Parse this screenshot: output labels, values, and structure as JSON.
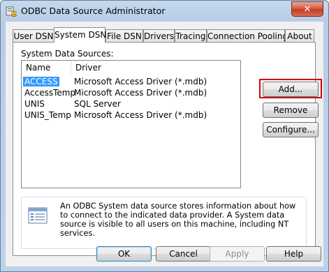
{
  "window": {
    "title": "ODBC Data Source Administrator",
    "close_glyph": "✕"
  },
  "tabs": [
    {
      "label": "User DSN",
      "active": false
    },
    {
      "label": "System DSN",
      "active": true
    },
    {
      "label": "File DSN",
      "active": false
    },
    {
      "label": "Drivers",
      "active": false
    },
    {
      "label": "Tracing",
      "active": false
    },
    {
      "label": "Connection Pooling",
      "active": false
    },
    {
      "label": "About",
      "active": false
    }
  ],
  "system_dsn": {
    "section_label": "System Data Sources:",
    "columns": [
      "Name",
      "Driver"
    ],
    "rows": [
      {
        "name": "ACCESS",
        "driver": "Microsoft Access Driver (*.mdb)",
        "selected": true
      },
      {
        "name": "AccessTemp",
        "driver": "Microsoft Access Driver (*.mdb)",
        "selected": false
      },
      {
        "name": "UNIS",
        "driver": "SQL Server",
        "selected": false
      },
      {
        "name": "UNIS_Temp",
        "driver": "Microsoft Access Driver (*.mdb)",
        "selected": false
      }
    ],
    "buttons": {
      "add": "Add...",
      "remove": "Remove",
      "configure": "Configure..."
    },
    "info_text": "An ODBC System data source stores information about how to connect to the indicated data provider.   A System data source is visible to all users on this machine, including NT services."
  },
  "footer_buttons": {
    "ok": "OK",
    "cancel": "Cancel",
    "apply": "Apply",
    "help": "Help"
  },
  "colors": {
    "selection": "#3399ff",
    "highlight_box": "#d40000",
    "close_button": "#c23b20"
  }
}
